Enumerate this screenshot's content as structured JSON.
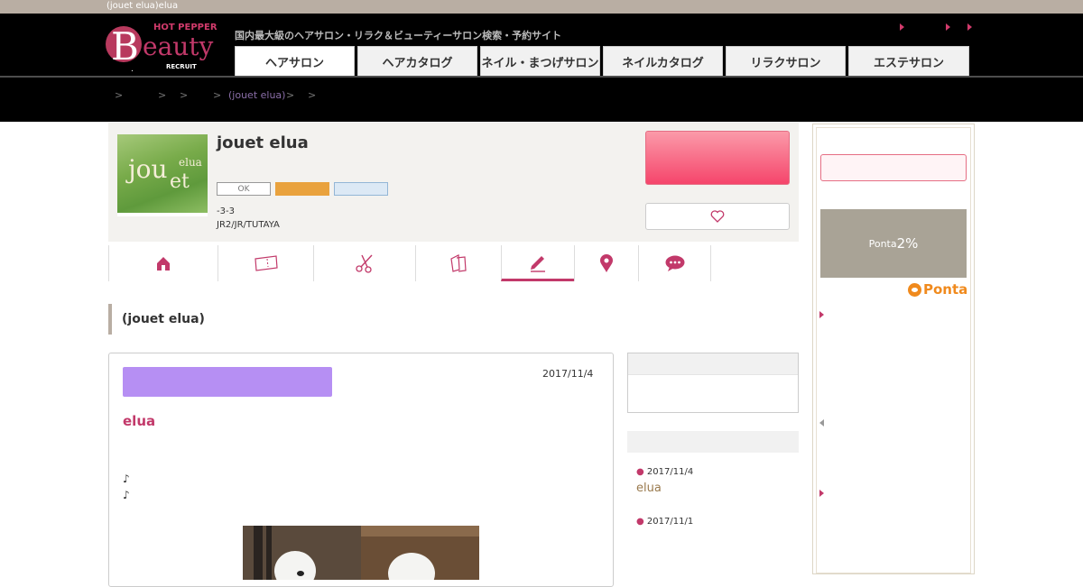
{
  "page": {
    "window_title": "(jouet elua)elua"
  },
  "header": {
    "logo": {
      "hotpepper": "HOT PEPPER",
      "b": "B",
      "eauty": "eauty",
      "company": "RECRUIT"
    },
    "tagline": "国内最大級のヘアサロン・リラク＆ビューティーサロン検索・予約サイト",
    "nav": [
      {
        "label": "ヘアサロン"
      },
      {
        "label": "ヘアカタログ"
      },
      {
        "label": "ネイル・まつげサロン"
      },
      {
        "label": "ネイルカタログ"
      },
      {
        "label": "リラクサロン"
      },
      {
        "label": "エステサロン"
      }
    ]
  },
  "breadcrumb": {
    "sep": ">",
    "salon": "(jouet elua)"
  },
  "salon": {
    "name": "jouet elua",
    "photo_text": {
      "t1": "jou",
      "t2": "elua",
      "t3": "et"
    },
    "badge_ok": "OK",
    "address": "-3-3",
    "access": "JR2/JR/TUTAYA"
  },
  "subnav": [
    {
      "icon": "home-icon"
    },
    {
      "icon": "coupon-icon"
    },
    {
      "icon": "scissors-icon"
    },
    {
      "icon": "catalog-icon"
    },
    {
      "icon": "pencil-icon"
    },
    {
      "icon": "map-pin-icon"
    },
    {
      "icon": "chat-icon"
    }
  ],
  "section_title": "(jouet elua)",
  "post": {
    "date": "2017/11/4",
    "title": "elua",
    "lines": [
      "♪",
      "♪"
    ]
  },
  "recent": [
    {
      "date": "2017/11/4",
      "title": "elua"
    },
    {
      "date": "2017/11/1"
    }
  ],
  "right": {
    "ponta_prefix": "Ponta",
    "ponta_rate": "2%",
    "ponta_logo": "Ponta"
  },
  "colors": {
    "accent": "#c2396a",
    "reserve": "#f5456b",
    "category": "#b68ff3"
  }
}
